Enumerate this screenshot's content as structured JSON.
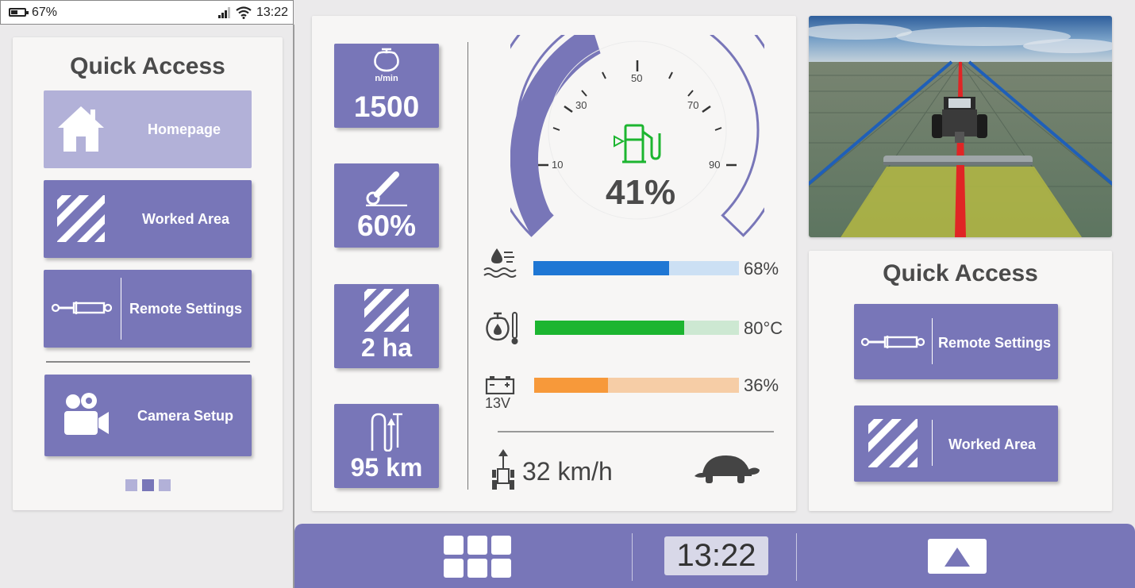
{
  "status_bar": {
    "battery": "67%",
    "time": "13:22"
  },
  "left_panel": {
    "title": "Quick Access",
    "buttons": [
      {
        "label": "Homepage",
        "icon": "home-icon"
      },
      {
        "label": "Worked Area",
        "icon": "stripes-icon"
      },
      {
        "label": "Remote Settings",
        "icon": "hydraulic-cylinder-icon"
      },
      {
        "label": "Camera Setup",
        "icon": "camera-icon"
      }
    ],
    "pager": {
      "pages": 3,
      "active": 2
    }
  },
  "dashboard": {
    "tiles": [
      {
        "value": "1500",
        "unit": "n/min",
        "icon": "engine-icon"
      },
      {
        "value": "60%",
        "icon": "pedal-icon"
      },
      {
        "value": "2 ha",
        "icon": "stripes-icon"
      },
      {
        "value": "95 km",
        "icon": "trip-route-icon"
      }
    ],
    "fuel_gauge": {
      "value": "41%",
      "level": 0.41,
      "ticks": [
        "10",
        "30",
        "50",
        "70",
        "90"
      ],
      "icon": "fuel-pump-icon"
    },
    "bars": [
      {
        "label": "68%",
        "fraction": 0.66,
        "icon": "coolant-icon",
        "fill": "#1f77d4",
        "track": "#cce0f4"
      },
      {
        "label": "80°C",
        "fraction": 0.73,
        "icon": "engine-temp-icon",
        "fill": "#1cb530",
        "track": "#cde8d2"
      },
      {
        "label": "36%",
        "fraction": 0.36,
        "icon": "battery-icon",
        "icon_caption": "13V",
        "fill": "#f7993a",
        "track": "#f6cda6"
      }
    ],
    "speed": {
      "value": "32 km/h",
      "icon": "tractor-speed-icon",
      "mode_icon": "turtle-icon"
    }
  },
  "right_panel": {
    "title": "Quick Access",
    "buttons": [
      {
        "label": "Remote Settings",
        "icon": "hydraulic-cylinder-icon"
      },
      {
        "label": "Worked Area",
        "icon": "stripes-icon"
      }
    ]
  },
  "bottom_bar": {
    "clock": "13:22",
    "menu_icon": "app-grid-icon",
    "up_icon": "up-triangle-icon"
  }
}
